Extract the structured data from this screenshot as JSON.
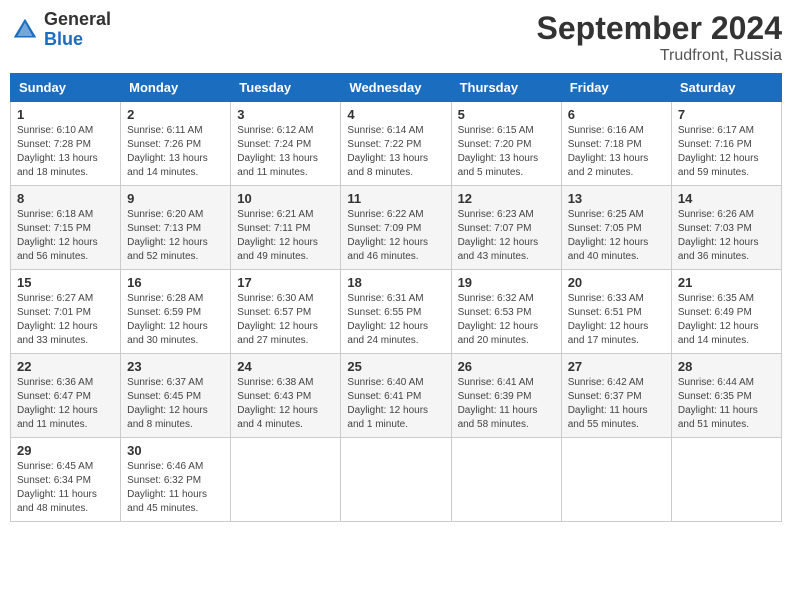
{
  "header": {
    "logo_general": "General",
    "logo_blue": "Blue",
    "month_year": "September 2024",
    "location": "Trudfront, Russia"
  },
  "days_of_week": [
    "Sunday",
    "Monday",
    "Tuesday",
    "Wednesday",
    "Thursday",
    "Friday",
    "Saturday"
  ],
  "weeks": [
    [
      {
        "day": "1",
        "sunrise": "6:10 AM",
        "sunset": "7:28 PM",
        "daylight": "13 hours and 18 minutes"
      },
      {
        "day": "2",
        "sunrise": "6:11 AM",
        "sunset": "7:26 PM",
        "daylight": "13 hours and 14 minutes"
      },
      {
        "day": "3",
        "sunrise": "6:12 AM",
        "sunset": "7:24 PM",
        "daylight": "13 hours and 11 minutes"
      },
      {
        "day": "4",
        "sunrise": "6:14 AM",
        "sunset": "7:22 PM",
        "daylight": "13 hours and 8 minutes"
      },
      {
        "day": "5",
        "sunrise": "6:15 AM",
        "sunset": "7:20 PM",
        "daylight": "13 hours and 5 minutes"
      },
      {
        "day": "6",
        "sunrise": "6:16 AM",
        "sunset": "7:18 PM",
        "daylight": "13 hours and 2 minutes"
      },
      {
        "day": "7",
        "sunrise": "6:17 AM",
        "sunset": "7:16 PM",
        "daylight": "12 hours and 59 minutes"
      }
    ],
    [
      {
        "day": "8",
        "sunrise": "6:18 AM",
        "sunset": "7:15 PM",
        "daylight": "12 hours and 56 minutes"
      },
      {
        "day": "9",
        "sunrise": "6:20 AM",
        "sunset": "7:13 PM",
        "daylight": "12 hours and 52 minutes"
      },
      {
        "day": "10",
        "sunrise": "6:21 AM",
        "sunset": "7:11 PM",
        "daylight": "12 hours and 49 minutes"
      },
      {
        "day": "11",
        "sunrise": "6:22 AM",
        "sunset": "7:09 PM",
        "daylight": "12 hours and 46 minutes"
      },
      {
        "day": "12",
        "sunrise": "6:23 AM",
        "sunset": "7:07 PM",
        "daylight": "12 hours and 43 minutes"
      },
      {
        "day": "13",
        "sunrise": "6:25 AM",
        "sunset": "7:05 PM",
        "daylight": "12 hours and 40 minutes"
      },
      {
        "day": "14",
        "sunrise": "6:26 AM",
        "sunset": "7:03 PM",
        "daylight": "12 hours and 36 minutes"
      }
    ],
    [
      {
        "day": "15",
        "sunrise": "6:27 AM",
        "sunset": "7:01 PM",
        "daylight": "12 hours and 33 minutes"
      },
      {
        "day": "16",
        "sunrise": "6:28 AM",
        "sunset": "6:59 PM",
        "daylight": "12 hours and 30 minutes"
      },
      {
        "day": "17",
        "sunrise": "6:30 AM",
        "sunset": "6:57 PM",
        "daylight": "12 hours and 27 minutes"
      },
      {
        "day": "18",
        "sunrise": "6:31 AM",
        "sunset": "6:55 PM",
        "daylight": "12 hours and 24 minutes"
      },
      {
        "day": "19",
        "sunrise": "6:32 AM",
        "sunset": "6:53 PM",
        "daylight": "12 hours and 20 minutes"
      },
      {
        "day": "20",
        "sunrise": "6:33 AM",
        "sunset": "6:51 PM",
        "daylight": "12 hours and 17 minutes"
      },
      {
        "day": "21",
        "sunrise": "6:35 AM",
        "sunset": "6:49 PM",
        "daylight": "12 hours and 14 minutes"
      }
    ],
    [
      {
        "day": "22",
        "sunrise": "6:36 AM",
        "sunset": "6:47 PM",
        "daylight": "12 hours and 11 minutes"
      },
      {
        "day": "23",
        "sunrise": "6:37 AM",
        "sunset": "6:45 PM",
        "daylight": "12 hours and 8 minutes"
      },
      {
        "day": "24",
        "sunrise": "6:38 AM",
        "sunset": "6:43 PM",
        "daylight": "12 hours and 4 minutes"
      },
      {
        "day": "25",
        "sunrise": "6:40 AM",
        "sunset": "6:41 PM",
        "daylight": "12 hours and 1 minute"
      },
      {
        "day": "26",
        "sunrise": "6:41 AM",
        "sunset": "6:39 PM",
        "daylight": "11 hours and 58 minutes"
      },
      {
        "day": "27",
        "sunrise": "6:42 AM",
        "sunset": "6:37 PM",
        "daylight": "11 hours and 55 minutes"
      },
      {
        "day": "28",
        "sunrise": "6:44 AM",
        "sunset": "6:35 PM",
        "daylight": "11 hours and 51 minutes"
      }
    ],
    [
      {
        "day": "29",
        "sunrise": "6:45 AM",
        "sunset": "6:34 PM",
        "daylight": "11 hours and 48 minutes"
      },
      {
        "day": "30",
        "sunrise": "6:46 AM",
        "sunset": "6:32 PM",
        "daylight": "11 hours and 45 minutes"
      },
      null,
      null,
      null,
      null,
      null
    ]
  ]
}
